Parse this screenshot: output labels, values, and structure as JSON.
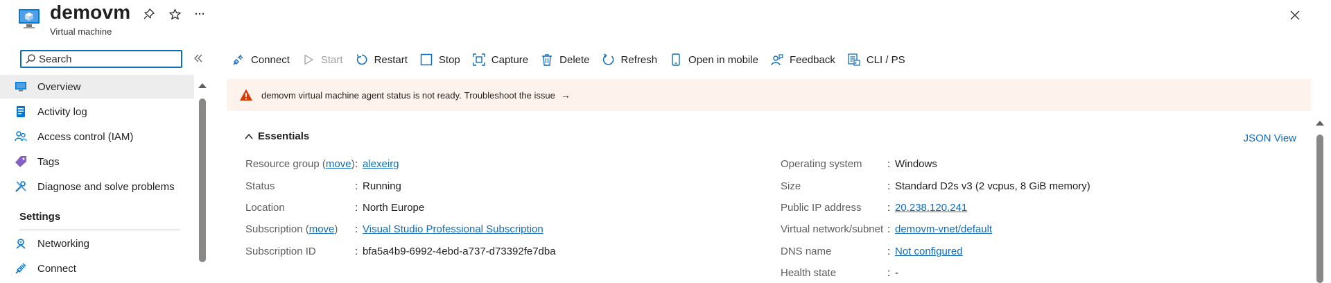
{
  "header": {
    "title": "demovm",
    "subtitle": "Virtual machine"
  },
  "search": {
    "placeholder": "Search",
    "value": ""
  },
  "nav": {
    "items": [
      {
        "label": "Overview",
        "icon": "monitor-icon"
      },
      {
        "label": "Activity log",
        "icon": "log-icon"
      },
      {
        "label": "Access control (IAM)",
        "icon": "people-icon"
      },
      {
        "label": "Tags",
        "icon": "tag-icon"
      },
      {
        "label": "Diagnose and solve problems",
        "icon": "wrench-icon"
      }
    ],
    "section_title": "Settings",
    "settings_items": [
      {
        "label": "Networking",
        "icon": "network-icon"
      },
      {
        "label": "Connect",
        "icon": "plug-icon"
      }
    ]
  },
  "toolbar": {
    "connect": "Connect",
    "start": "Start",
    "restart": "Restart",
    "stop": "Stop",
    "capture": "Capture",
    "delete": "Delete",
    "refresh": "Refresh",
    "open_mobile": "Open in mobile",
    "feedback": "Feedback",
    "cli": "CLI / PS"
  },
  "banner": {
    "message": "demovm virtual machine agent status is not ready.",
    "link": "Troubleshoot the issue",
    "arrow": "→"
  },
  "essentials": {
    "title": "Essentials",
    "json_view": "JSON View",
    "left": {
      "resource_group_label": "Resource group",
      "move": "move",
      "resource_group_value": "alexeirg",
      "status_label": "Status",
      "status_value": "Running",
      "location_label": "Location",
      "location_value": "North Europe",
      "subscription_label": "Subscription",
      "subscription_value": "Visual Studio Professional Subscription",
      "subscription_id_label": "Subscription ID",
      "subscription_id_value": "bfa5a4b9-6992-4ebd-a737-d73392fe7dba"
    },
    "right": {
      "os_label": "Operating system",
      "os_value": "Windows",
      "size_label": "Size",
      "size_value": "Standard D2s v3 (2 vcpus, 8 GiB memory)",
      "ip_label": "Public IP address",
      "ip_value": "20.238.120.241",
      "vnet_label": "Virtual network/subnet",
      "vnet_value": "demovm-vnet/default",
      "dns_label": "DNS name",
      "dns_value": "Not configured",
      "health_label": "Health state",
      "health_value": "-"
    }
  },
  "colors": {
    "accent": "#0f6cbd",
    "warning": "#d83b01",
    "banner_bg": "#fdf3ec"
  }
}
